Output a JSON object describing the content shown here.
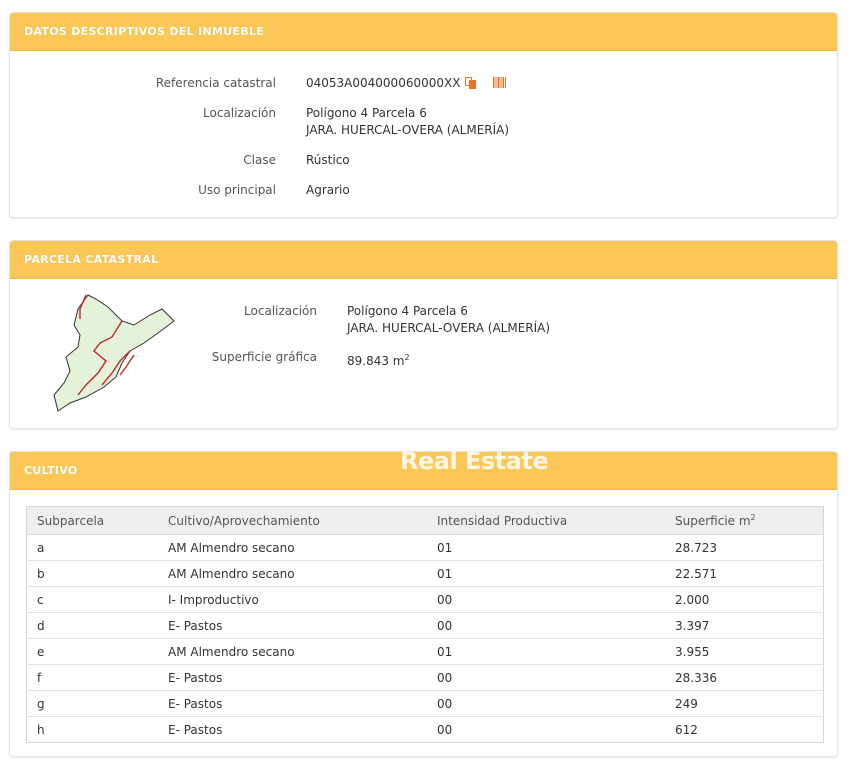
{
  "datos": {
    "header": "DATOS DESCRIPTIVOS DEL INMUEBLE",
    "ref_label": "Referencia catastral",
    "ref_value": "04053A004000060000XX",
    "loc_label": "Localización",
    "loc_line1": "Polígono 4 Parcela 6",
    "loc_line2": "JARA. HUERCAL-OVERA (ALMERÍA)",
    "clase_label": "Clase",
    "clase_value": "Rústico",
    "uso_label": "Uso principal",
    "uso_value": "Agrario",
    "icons": [
      "copy-icon",
      "barcode-icon"
    ],
    "icon_color": "#e8742a"
  },
  "parcela": {
    "header": "PARCELA CATASTRAL",
    "loc_label": "Localización",
    "loc_line1": "Polígono 4 Parcela 6",
    "loc_line2": "JARA. HUERCAL-OVERA (ALMERÍA)",
    "sup_label": "Superficie gráfica",
    "sup_value": "89.843 m",
    "sup_exp": "2",
    "map_colors": {
      "fill": "#e3f2d8",
      "outline": "#333333",
      "subdivision": "#c0282a"
    }
  },
  "watermark": "Real Estate",
  "cultivo": {
    "header": "CULTIVO",
    "columns": [
      "Subparcela",
      "Cultivo/Aprovechamiento",
      "Intensidad Productiva",
      "Superficie m"
    ],
    "col4_exp": "2",
    "rows": [
      [
        "a",
        "AM Almendro secano",
        "01",
        "28.723"
      ],
      [
        "b",
        "AM Almendro secano",
        "01",
        "22.571"
      ],
      [
        "c",
        "I- Improductivo",
        "00",
        "2.000"
      ],
      [
        "d",
        "E- Pastos",
        "00",
        "3.397"
      ],
      [
        "e",
        "AM Almendro secano",
        "01",
        "3.955"
      ],
      [
        "f",
        "E- Pastos",
        "00",
        "28.336"
      ],
      [
        "g",
        "E- Pastos",
        "00",
        "249"
      ],
      [
        "h",
        "E- Pastos",
        "00",
        "612"
      ]
    ]
  },
  "colors": {
    "header_bg": "#fbc756",
    "header_text": "#ffffff"
  }
}
